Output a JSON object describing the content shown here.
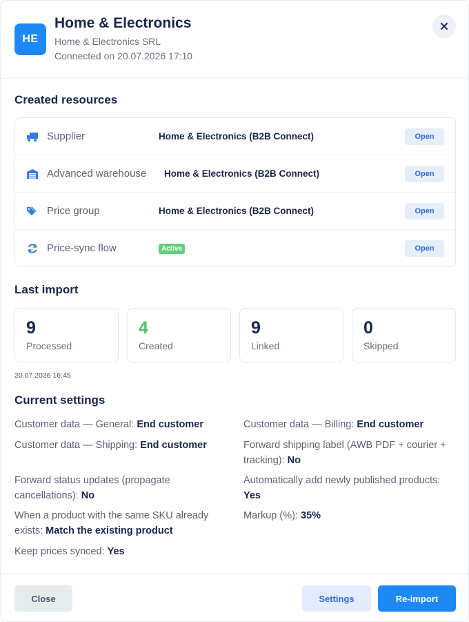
{
  "header": {
    "avatar_initials": "HE",
    "title": "Home & Electronics",
    "company": "Home & Electronics SRL",
    "connected": "Connected on 20.07.2026 17:10",
    "close_icon": "×"
  },
  "resources": {
    "title": "Created resources",
    "open_label": "Open",
    "items": [
      {
        "icon": "truck-icon",
        "label": "Supplier",
        "value": "Home & Electronics (B2B Connect)"
      },
      {
        "icon": "warehouse-icon",
        "label": "Advanced warehouse",
        "value": "Home & Electronics (B2B Connect)"
      },
      {
        "icon": "price-tag-icon",
        "label": "Price group",
        "value": "Home & Electronics (B2B Connect)"
      },
      {
        "icon": "sync-icon",
        "label": "Price-sync flow",
        "badge": "Active"
      }
    ]
  },
  "last_import": {
    "title": "Last import",
    "stats": [
      {
        "value": "9",
        "label": "Processed",
        "color": "#1a2550"
      },
      {
        "value": "4",
        "label": "Created",
        "color": "#4cc36b"
      },
      {
        "value": "9",
        "label": "Linked",
        "color": "#1a2550"
      },
      {
        "value": "0",
        "label": "Skipped",
        "color": "#1a2550"
      }
    ],
    "timestamp": "20.07.2026 16:45"
  },
  "settings": {
    "title": "Current settings",
    "items": [
      {
        "label": "Customer data — General:",
        "value": "End customer"
      },
      {
        "label": "Customer data — Billing:",
        "value": "End customer"
      },
      {
        "label": "Customer data — Shipping:",
        "value": "End customer"
      },
      {
        "label": "Forward shipping label (AWB PDF + courier + tracking):",
        "value": "No"
      },
      {
        "label": "Forward status updates (propagate cancellations):",
        "value": "No"
      },
      {
        "label": "Automatically add newly published products:",
        "value": "Yes"
      },
      {
        "label": "When a product with the same SKU already exists:",
        "value": "Match the existing product"
      },
      {
        "label": "Markup (%):",
        "value": "35%"
      },
      {
        "label": "Keep prices synced:",
        "value": "Yes"
      }
    ]
  },
  "footer": {
    "close_label": "Close",
    "settings_label": "Settings",
    "reimport_label": "Re-import"
  },
  "colors": {
    "accent": "#1e88f5",
    "success": "#5fd17a",
    "text_dark": "#1a2550",
    "icon_blue": "#2f7de1"
  }
}
